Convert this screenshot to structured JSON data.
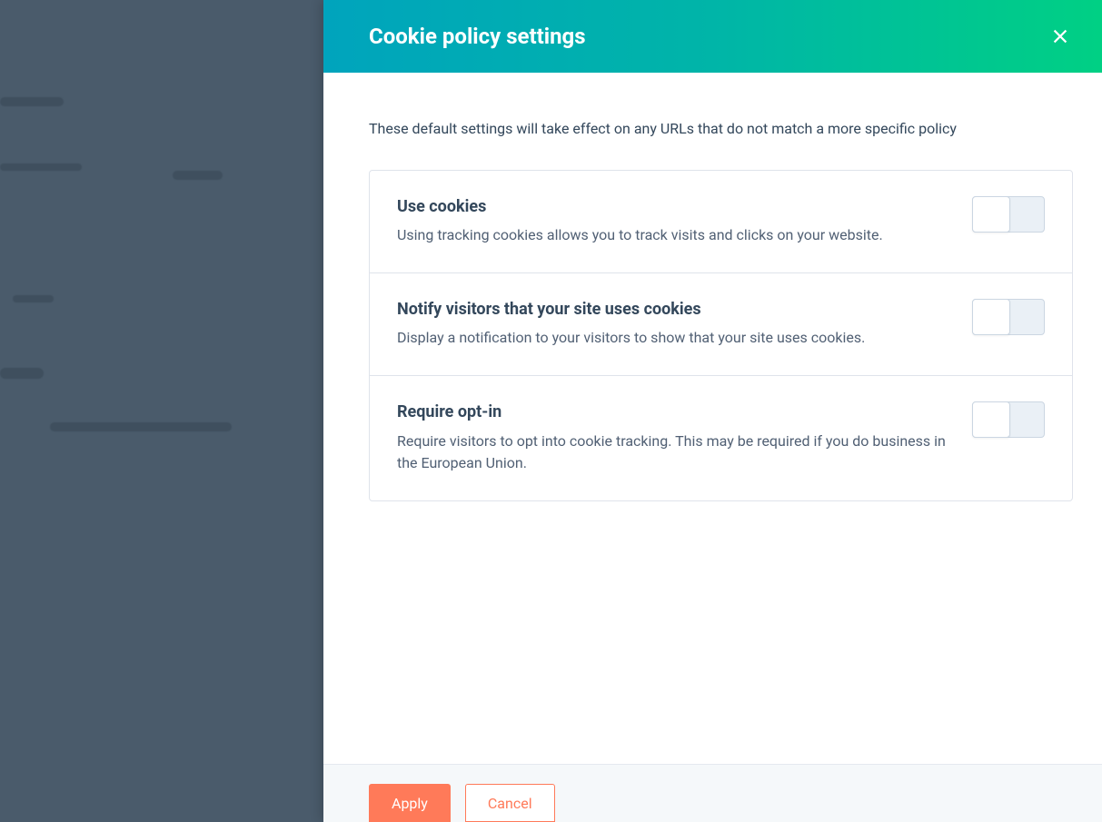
{
  "panel": {
    "title": "Cookie policy settings",
    "intro": "These default settings will take effect on any URLs that do not match a more specific policy"
  },
  "settings": [
    {
      "title": "Use cookies",
      "description": "Using tracking cookies allows you to track visits and clicks on your website.",
      "on": false
    },
    {
      "title": "Notify visitors that your site uses cookies",
      "description": "Display a notification to your visitors to show that your site uses cookies.",
      "on": false
    },
    {
      "title": "Require opt-in",
      "description": "Require visitors to opt into cookie tracking. This may be required if you do business in the European Union.",
      "on": false
    }
  ],
  "footer": {
    "apply": "Apply",
    "cancel": "Cancel"
  }
}
